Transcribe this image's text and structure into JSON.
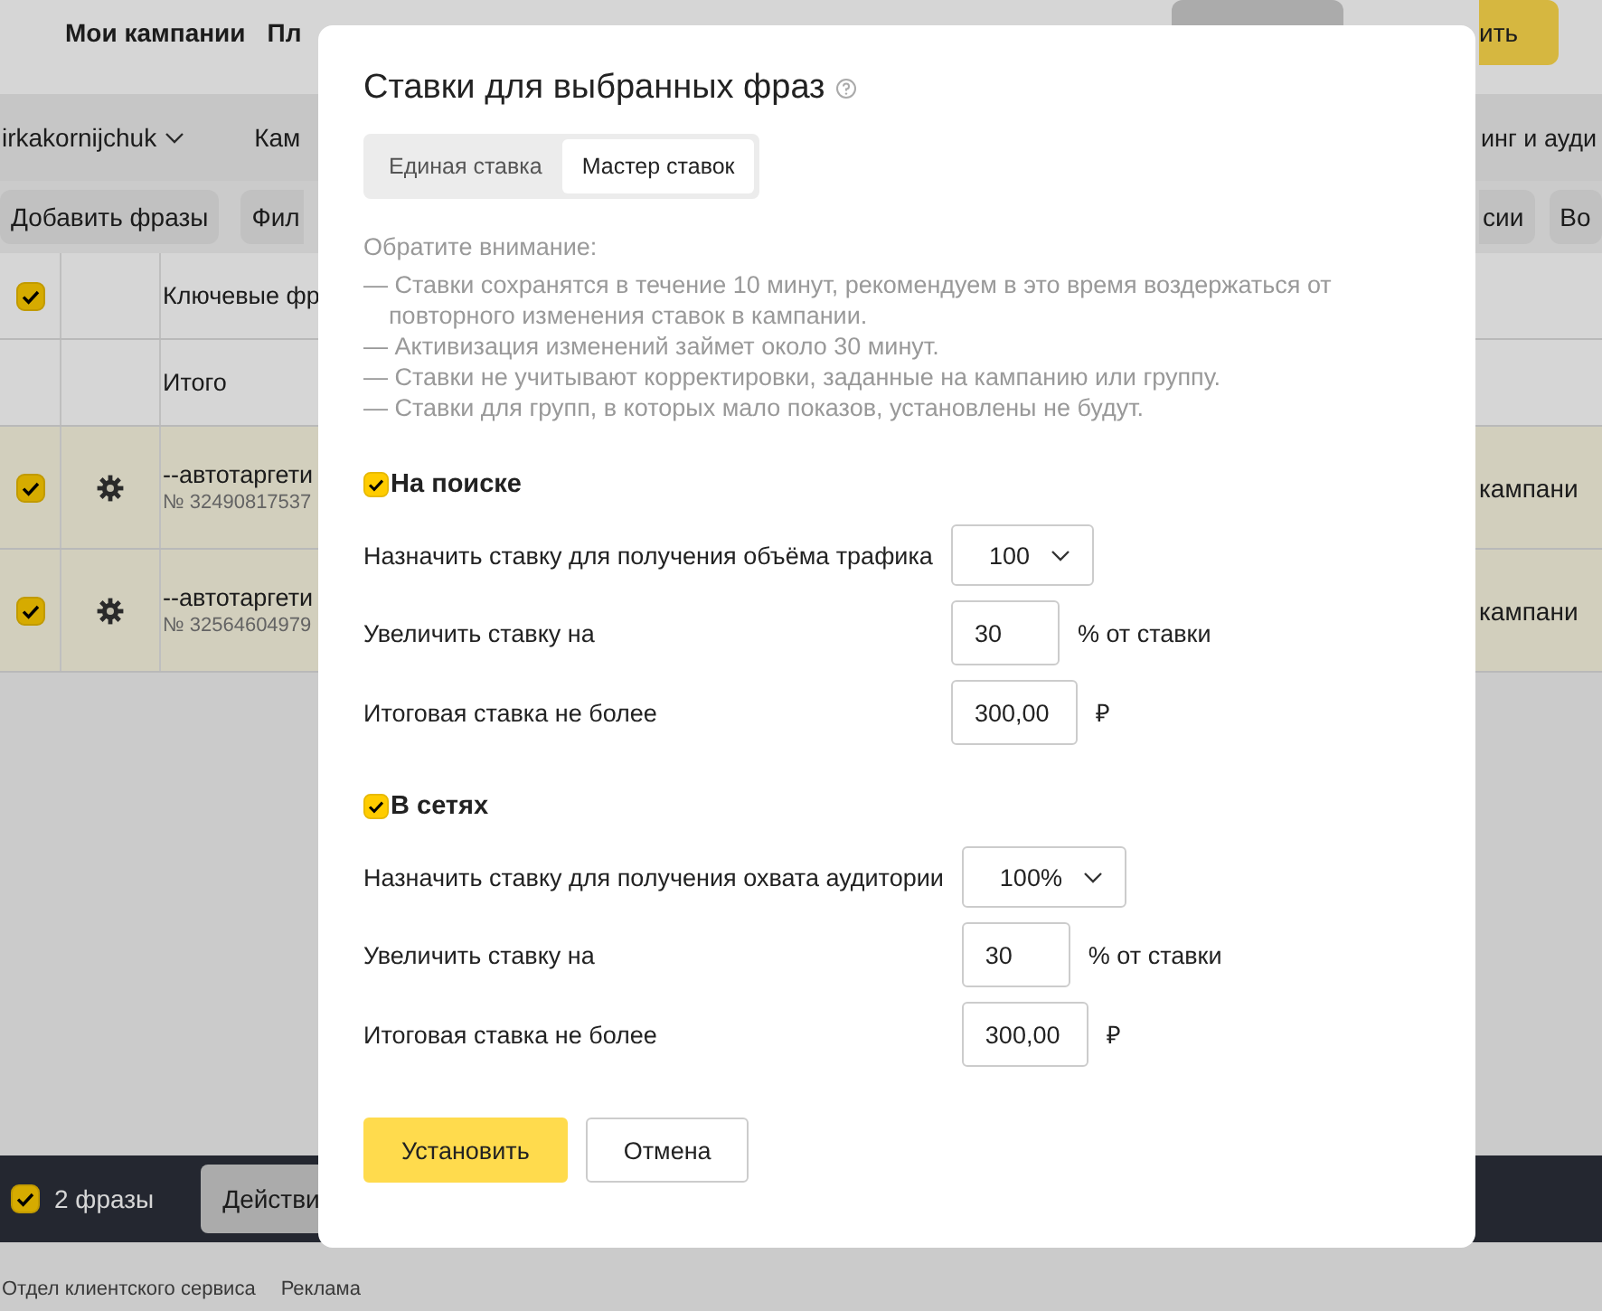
{
  "background": {
    "nav": [
      "Мои кампании",
      "Пл"
    ],
    "top_button": "ить",
    "account": "irkakornijchuk",
    "subnav": [
      "Кам",
      "инг и ауди"
    ],
    "toolbar": [
      "Добавить фразы",
      "Фил",
      "сии",
      "Во"
    ],
    "table": {
      "header_checked": true,
      "columns": [
        "Ключевые фр"
      ],
      "total_label": "Итого",
      "rows": [
        {
          "checked": true,
          "name": "--автотаргети",
          "number": "№ 32490817537",
          "column_3": "кампани"
        },
        {
          "checked": true,
          "name": "--автотаргети",
          "number": "№ 32564604979",
          "column_3": "кампани"
        }
      ]
    },
    "bottom_bar": {
      "checked": true,
      "count": "2 фразы",
      "action": "Действи"
    },
    "footer": [
      "Отдел клиентского сервиса",
      "Реклама"
    ]
  },
  "dialog": {
    "title": "Ставки для выбранных фраз",
    "tabs": [
      {
        "label": "Единая ставка",
        "selected": false
      },
      {
        "label": "Мастер ставок",
        "selected": true
      }
    ],
    "notice": {
      "title": "Обратите внимание:",
      "items": [
        "— Ставки сохранятся в течение 10 минут, рекомендуем в это время воздержаться от повторного изменения ставок в кампании.",
        "— Активизация изменений займет около 30 минут.",
        "— Ставки не учитывают корректировки, заданные на кампанию или группу.",
        "— Ставки для групп, в которых мало показов, установлены не будут."
      ]
    },
    "sections": [
      {
        "label": "На поиске",
        "checked": true,
        "rows": [
          {
            "kind": "select",
            "label": "Назначить ставку для получения объёма трафика",
            "value": "100"
          },
          {
            "kind": "input",
            "label": "Увеличить ставку на",
            "value": "30",
            "suffix": "% от ставки"
          },
          {
            "kind": "input",
            "label": "Итоговая ставка не более",
            "value": "300,00",
            "suffix": "₽"
          }
        ]
      },
      {
        "label": "В сетях",
        "checked": true,
        "rows": [
          {
            "kind": "select",
            "label": "Назначить ставку для получения охвата аудитории",
            "value": "100%"
          },
          {
            "kind": "input",
            "label": "Увеличить ставку на",
            "value": "30",
            "suffix": "% от ставки"
          },
          {
            "kind": "input",
            "label": "Итоговая ставка не более",
            "value": "300,00",
            "suffix": "₽"
          }
        ]
      }
    ],
    "buttons": [
      {
        "label": "Установить",
        "kind": "primary"
      },
      {
        "label": "Отмена",
        "kind": "secondary"
      }
    ]
  }
}
